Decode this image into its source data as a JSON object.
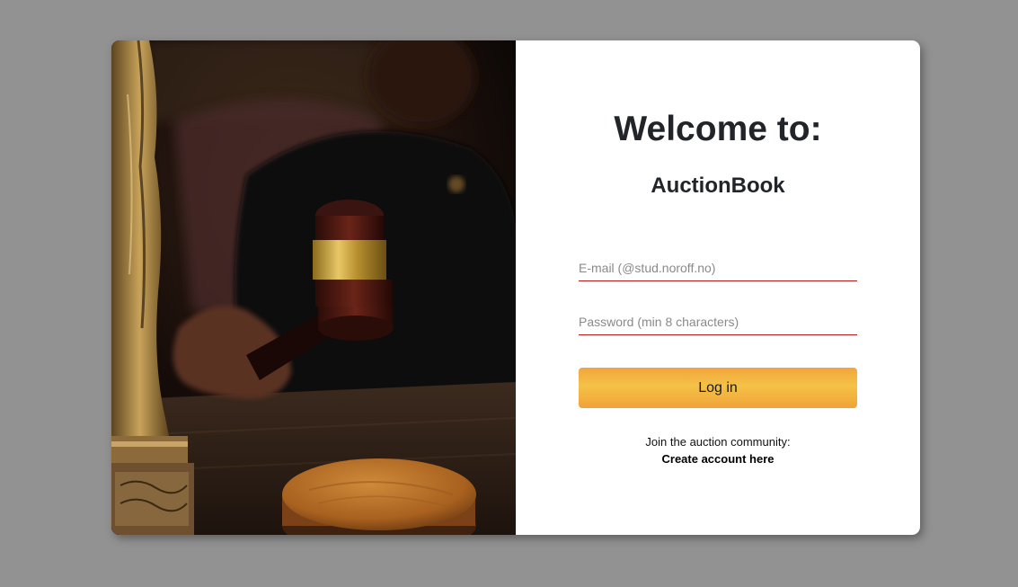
{
  "hero": {
    "image_alt": "Judge holding a gavel next to a Lady Justice statue"
  },
  "login": {
    "welcome_heading": "Welcome to:",
    "brand_name": "AuctionBook",
    "email_placeholder": "E-mail (@stud.noroff.no)",
    "email_value": "",
    "password_placeholder": "Password (min 8 characters)",
    "password_value": "",
    "login_button_label": "Log in",
    "join_text": "Join the auction community:",
    "create_account_link": "Create account here"
  },
  "colors": {
    "page_background": "#929292",
    "card_background": "#ffffff",
    "input_underline": "#b71c1c",
    "button_gradient_top": "#f2a53c",
    "button_gradient_mid": "#f4c247"
  }
}
